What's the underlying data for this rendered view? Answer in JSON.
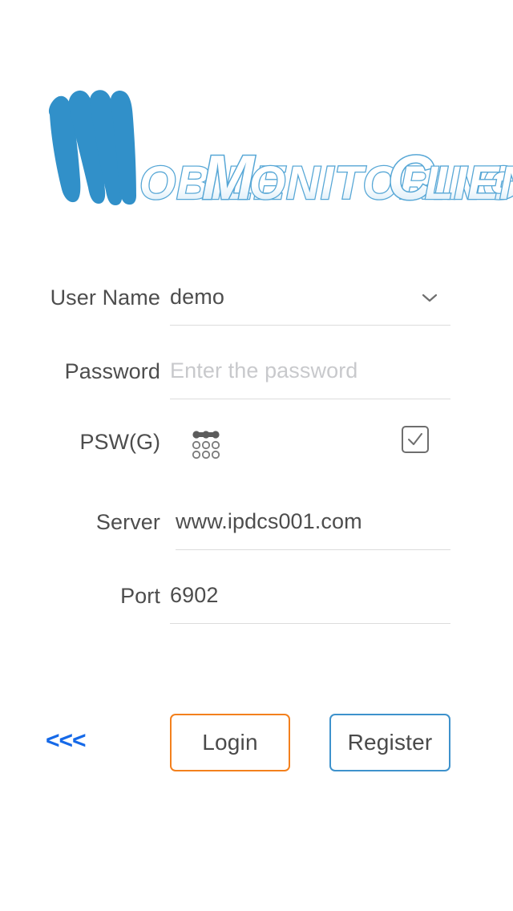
{
  "app": {
    "logo": {
      "mark_letter": "M",
      "text": "obile Monitoring Client",
      "word1": "obile",
      "word2_cap": "M",
      "word2": "onitoring",
      "word3_cap": "C",
      "word3": "lient",
      "brand_blue": "#3190c9",
      "outline_blue": "#57a7d6"
    }
  },
  "form": {
    "rows": [
      {
        "label": "User Name",
        "value": "demo",
        "placeholder": "",
        "type": "dropdown",
        "icon": "chevron-down-icon"
      },
      {
        "label": "Password",
        "value": "",
        "placeholder": "Enter the password",
        "type": "password",
        "icon": ""
      },
      {
        "label": "PSW(G)",
        "value": "",
        "placeholder": "",
        "type": "pattern",
        "icon": "pattern-lock-icon",
        "checked": true
      },
      {
        "label": "Server",
        "value": "www.ipdcs001.com",
        "placeholder": "",
        "type": "text",
        "icon": ""
      },
      {
        "label": "Port",
        "value": "6902",
        "placeholder": "",
        "type": "text",
        "icon": ""
      }
    ]
  },
  "actions": {
    "back_label": "<<<",
    "login_label": "Login",
    "register_label": "Register",
    "login_border_color": "#f3801d",
    "register_border_color": "#3e92cc",
    "back_color": "#1569e8"
  }
}
